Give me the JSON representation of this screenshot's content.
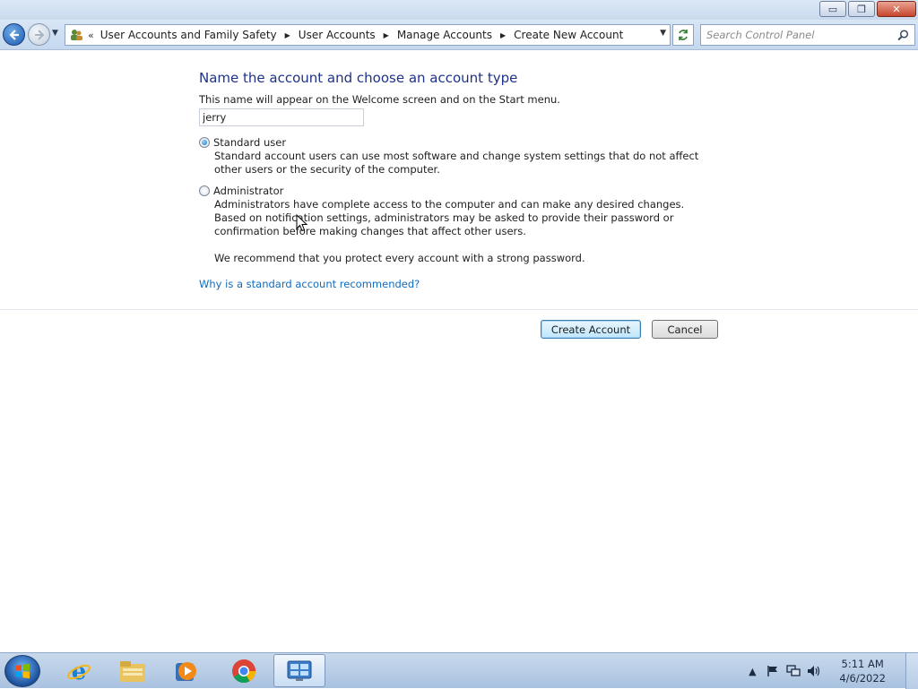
{
  "window": {
    "minimize": "▭",
    "restore": "❐",
    "close": "✕"
  },
  "nav": {
    "crumbs": [
      "User Accounts and Family Safety",
      "User Accounts",
      "Manage Accounts",
      "Create New Account"
    ],
    "search_placeholder": "Search Control Panel"
  },
  "form": {
    "heading": "Name the account and choose an account type",
    "description": "This name will appear on the Welcome screen and on the Start menu.",
    "name_value": "jerry",
    "options": [
      {
        "label": "Standard user",
        "selected": true,
        "description": "Standard account users can use most software and change system settings that do not affect other users or the security of the computer."
      },
      {
        "label": "Administrator",
        "selected": false,
        "description": "Administrators have complete access to the computer and can make any desired changes. Based on notification settings, administrators may be asked to provide their password or confirmation before making changes that affect other users."
      }
    ],
    "recommendation": "We recommend that you protect every account with a strong password.",
    "help_link": "Why is a standard account recommended?",
    "create_button": "Create Account",
    "cancel_button": "Cancel"
  },
  "taskbar": {
    "apps": [
      "internet-explorer",
      "file-explorer",
      "media-player",
      "chrome",
      "control-panel"
    ],
    "time": "5:11 AM",
    "date": "4/6/2022"
  },
  "colors": {
    "heading": "#1e3287",
    "link": "#0e6cbf",
    "accent": "#3c7fb1"
  }
}
